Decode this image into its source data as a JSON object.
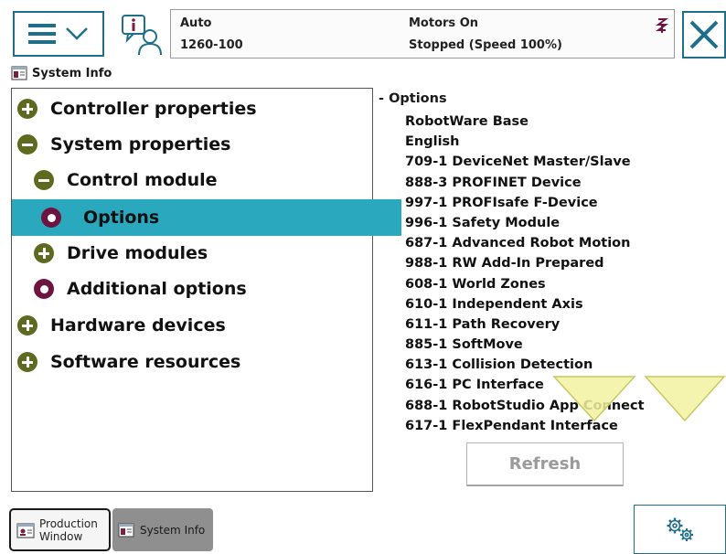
{
  "header": {
    "operating_mode": "Auto",
    "system_name": "1260-100",
    "motors_state": "Motors On",
    "run_state": "Stopped (Speed 100%)"
  },
  "app": {
    "title": "System Info"
  },
  "tree": {
    "items": [
      {
        "label": "Controller properties",
        "state": "collapsed"
      },
      {
        "label": "System properties",
        "state": "expanded"
      },
      {
        "label": "Control module",
        "state": "expanded"
      },
      {
        "label": "Options",
        "state": "leaf",
        "selected": true
      },
      {
        "label": "Drive modules",
        "state": "collapsed"
      },
      {
        "label": "Additional options",
        "state": "leaf"
      },
      {
        "label": "Hardware devices",
        "state": "collapsed"
      },
      {
        "label": "Software resources",
        "state": "collapsed"
      }
    ]
  },
  "options_panel": {
    "header": "- Options",
    "items": [
      "RobotWare Base",
      "English",
      "709-1 DeviceNet Master/Slave",
      "888-3 PROFINET Device",
      "997-1 PROFIsafe F-Device",
      "996-1 Safety Module",
      "687-1 Advanced Robot Motion",
      "988-1 RW Add-In Prepared",
      "608-1 World Zones",
      "610-1 Independent Axis",
      "611-1 Path Recovery",
      "885-1 SoftMove",
      "613-1 Collision Detection",
      "616-1 PC Interface",
      "688-1 RobotStudio App Connect",
      "617-1 FlexPendant Interface"
    ],
    "refresh_label": "Refresh"
  },
  "taskbar": {
    "tasks": [
      {
        "label_line1": "Production",
        "label_line2": "Window",
        "active": false
      },
      {
        "label": "System Info",
        "active": true
      }
    ]
  },
  "icons": {
    "menu": "hamburger-icon",
    "dropdown": "chevron-down-icon",
    "event_log": "info-person-icon",
    "jog": "jog-icon",
    "close": "close-icon",
    "app": "system-info-icon",
    "settings": "gears-icon"
  },
  "colors": {
    "accent": "#1f6f8b",
    "selection": "#2aa8bd",
    "node_expandable": "#5d6a1f",
    "node_leaf": "#6e1440",
    "annotation_triangle": "#f2f2a0"
  }
}
